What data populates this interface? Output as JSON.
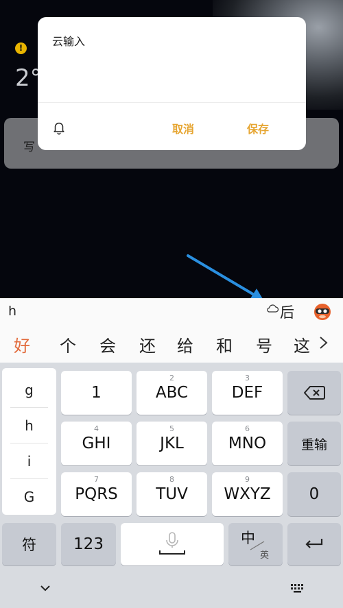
{
  "background": {
    "temp_fragment": "2°",
    "card_fragment": "写",
    "warn_glyph": "!"
  },
  "dialog": {
    "text": "云输入",
    "cancel_label": "取消",
    "save_label": "保存",
    "accent_color": "#e6a531"
  },
  "keyboard": {
    "composition": "h",
    "cloud_candidate": "后",
    "candidates": [
      "好",
      "个",
      "会",
      "还",
      "给",
      "和",
      "号",
      "这"
    ],
    "more_glyph": ">",
    "pinyin_options": [
      "g",
      "h",
      "i",
      "G"
    ],
    "keys": [
      {
        "main": "1",
        "sub": ""
      },
      {
        "main": "ABC",
        "sub": "2"
      },
      {
        "main": "DEF",
        "sub": "3"
      },
      {
        "main": "GHI",
        "sub": "4"
      },
      {
        "main": "JKL",
        "sub": "5"
      },
      {
        "main": "MNO",
        "sub": "6"
      },
      {
        "main": "PQRS",
        "sub": "7"
      },
      {
        "main": "TUV",
        "sub": "8"
      },
      {
        "main": "WXYZ",
        "sub": "9"
      }
    ],
    "retype_label": "重输",
    "zero_label": "0",
    "symbol_label": "符",
    "num_label": "123",
    "lang_main": "中",
    "lang_sub": "英"
  }
}
